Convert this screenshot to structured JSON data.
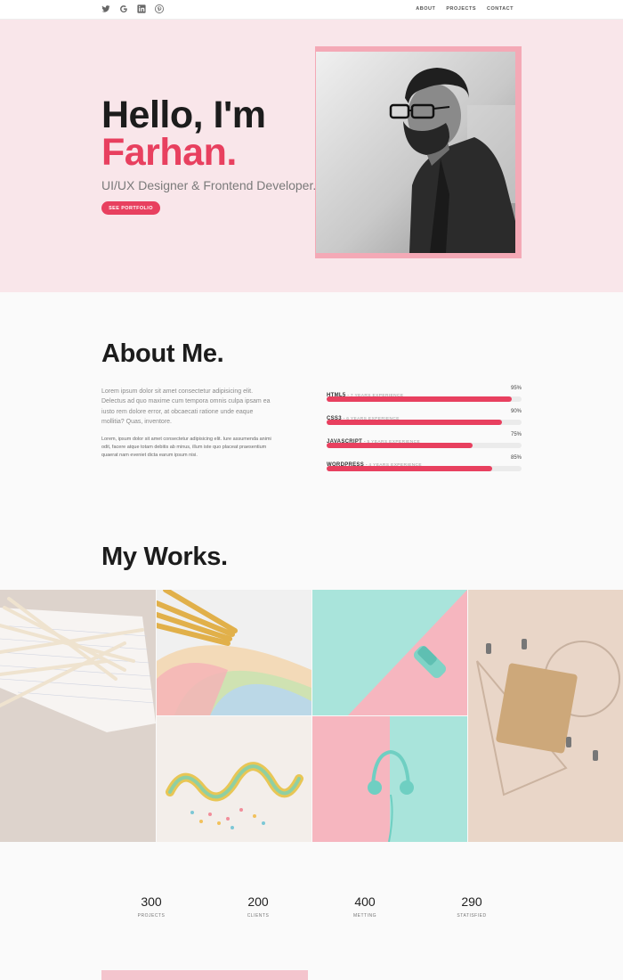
{
  "nav": {
    "socials": [
      "twitter-icon",
      "google-icon",
      "linkedin-icon",
      "pinterest-icon"
    ],
    "menu": [
      "ABOUT",
      "PROJECTS",
      "CONTACT"
    ]
  },
  "hero": {
    "greeting": "Hello, I'm",
    "name": "Farhan.",
    "role": "UI/UX Designer & Frontend Developer.",
    "cta": "SEE PORTFOLIO"
  },
  "about": {
    "title": "About Me.",
    "p1": "Lorem ipsum dolor sit amet consectetur adipisicing elit. Delectus ad quo maxime cum tempora omnis culpa ipsam ea iusto rem dolore error, at obcaecati ratione unde eaque mollitia? Quas, inventore.",
    "p2": "Lorem, ipsum dolor sit amet consectetur adipisicing elit. Iure assumenda animi odit, facere atque totam debitis ab minus, illum iste quo placeat praesentium quaerat nam eveniet dicta earum ipsum nisi.",
    "skills": [
      {
        "name": "HTML5",
        "experience": "7 YEARS EXPERIENCE",
        "percent_label": "95%",
        "percent": 95
      },
      {
        "name": "CSS3",
        "experience": "6 YEARS EXPERIENCE",
        "percent_label": "90%",
        "percent": 90
      },
      {
        "name": "JAVASCRIPT",
        "experience": "5 YEARS EXPERIENCE",
        "percent_label": "75%",
        "percent": 75
      },
      {
        "name": "WORDPRESS",
        "experience": "4 YEARS EXPERIENCE",
        "percent_label": "85%",
        "percent": 85
      }
    ]
  },
  "works": {
    "title": "My Works."
  },
  "stats": [
    {
      "value": "300",
      "label": "PROJECTS"
    },
    {
      "value": "200",
      "label": "CLIENTS"
    },
    {
      "value": "400",
      "label": "METTING"
    },
    {
      "value": "290",
      "label": "STATISFIED"
    }
  ],
  "colors": {
    "accent": "#e8405f",
    "hero_bg": "#f9e6ea",
    "frame": "#f4a9b6",
    "page_bg": "#fafafa"
  }
}
